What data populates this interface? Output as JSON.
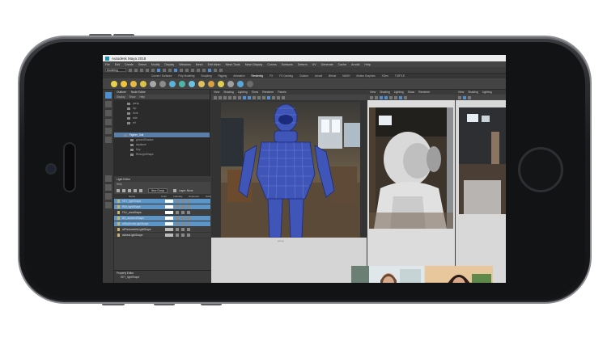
{
  "app": {
    "title": "Autodesk Maya 2018",
    "menus": [
      "File",
      "Edit",
      "Create",
      "Select",
      "Modify",
      "Display",
      "Windows",
      "Mesh",
      "Edit Mesh",
      "Mesh Tools",
      "Mesh Display",
      "Curves",
      "Surfaces",
      "Deform",
      "UV",
      "Generate",
      "Cache",
      "Arnold",
      "Help"
    ],
    "mode": "Modeling",
    "shelf_tabs": [
      "Curves / Surfaces",
      "Poly Modeling",
      "Sculpting",
      "Rigging",
      "Animation",
      "Rendering",
      "FX",
      "FX Caching",
      "Custom",
      "Arnold",
      "Bifrost",
      "MASH",
      "Motion Graphics",
      "XGen",
      "TURTLE"
    ]
  },
  "outliner": {
    "tabs": [
      "Outliner",
      "Node Editor"
    ],
    "menu": [
      "Display",
      "Show",
      "Help"
    ],
    "items": [
      "persp",
      "top",
      "front",
      "side",
      "ref",
      "Fighter_Suit",
      "groundShadow",
      "skydome",
      "Key",
      "RimLightShape"
    ]
  },
  "light_editor": {
    "title": "Light Editor",
    "menu": "Help",
    "new_group": "New Group",
    "layer_label": "Layer: None",
    "columns": [
      "Name",
      "Color",
      "Intensity",
      "Exposure",
      "Samples"
    ],
    "lights": [
      {
        "name": "KEY_lightShape",
        "selected": true
      },
      {
        "name": "RIM_lightShape",
        "selected": true
      },
      {
        "name": "FILL_areaShape",
        "selected": false
      },
      {
        "name": "BG_ambientShape",
        "selected": true
      },
      {
        "name": "aiSkyDomeLightShape",
        "selected": true
      },
      {
        "name": "aiPhotometricLightShape",
        "selected": false
      },
      {
        "name": "aiAreaLightShape",
        "selected": false
      }
    ]
  },
  "property_editor": {
    "title": "Property Editor",
    "value": "KEY_lightShape"
  },
  "viewports": {
    "menu": [
      "View",
      "Shading",
      "Lighting",
      "Show",
      "Renderer",
      "Panels"
    ],
    "resolution": "1024 x 1024",
    "caption": "persp"
  },
  "colors": {
    "selection": "#5d95c7",
    "accent": "#4f8fd0",
    "phone": "#1b1c1f"
  }
}
